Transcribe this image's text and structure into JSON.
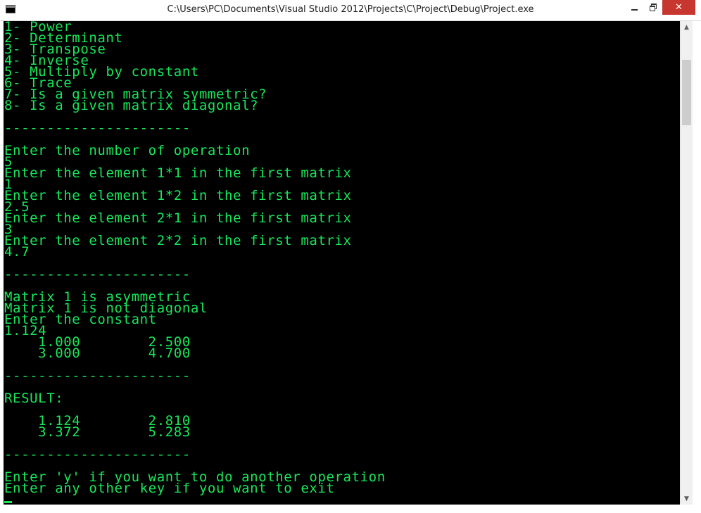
{
  "window": {
    "title": "C:\\Users\\PC\\Documents\\Visual Studio 2012\\Projects\\C\\Project\\Debug\\Project.exe",
    "icon": "console-app-icon",
    "controls": {
      "minimize_icon": "minimize-icon",
      "maximize_icon": "restore-icon",
      "close_label": "✕"
    }
  },
  "colors": {
    "console_background": "#000000",
    "console_text": "#16e85a",
    "close_button": "#c7372f",
    "scrollbar_track": "#f0f0f0",
    "scrollbar_thumb": "#cdcdcd"
  },
  "console": {
    "lines": [
      "1- Power",
      "2- Determinant",
      "3- Transpose",
      "4- Inverse",
      "5- Multiply by constant",
      "6- Trace",
      "7- Is a given matrix symmetric?",
      "8- Is a given matrix diagonal?",
      "",
      "----------------------",
      "",
      "Enter the number of operation",
      "5",
      "Enter the element 1*1 in the first matrix",
      "1",
      "Enter the element 1*2 in the first matrix",
      "2.5",
      "Enter the element 2*1 in the first matrix",
      "3",
      "Enter the element 2*2 in the first matrix",
      "4.7",
      "",
      "----------------------",
      "",
      "Matrix 1 is asymmetric",
      "Matrix 1 is not diagonal",
      "Enter the constant",
      "1.124",
      "    1.000        2.500",
      "    3.000        4.700",
      "",
      "----------------------",
      "",
      "RESULT:",
      "",
      "    1.124        2.810",
      "    3.372        5.283",
      "",
      "----------------------",
      "",
      "Enter 'y' if you want to do another operation",
      "Enter any other key if you want to exit"
    ]
  },
  "scrollbar": {
    "up_icon": "scroll-up-arrow-icon",
    "down_icon": "scroll-down-arrow-icon"
  }
}
